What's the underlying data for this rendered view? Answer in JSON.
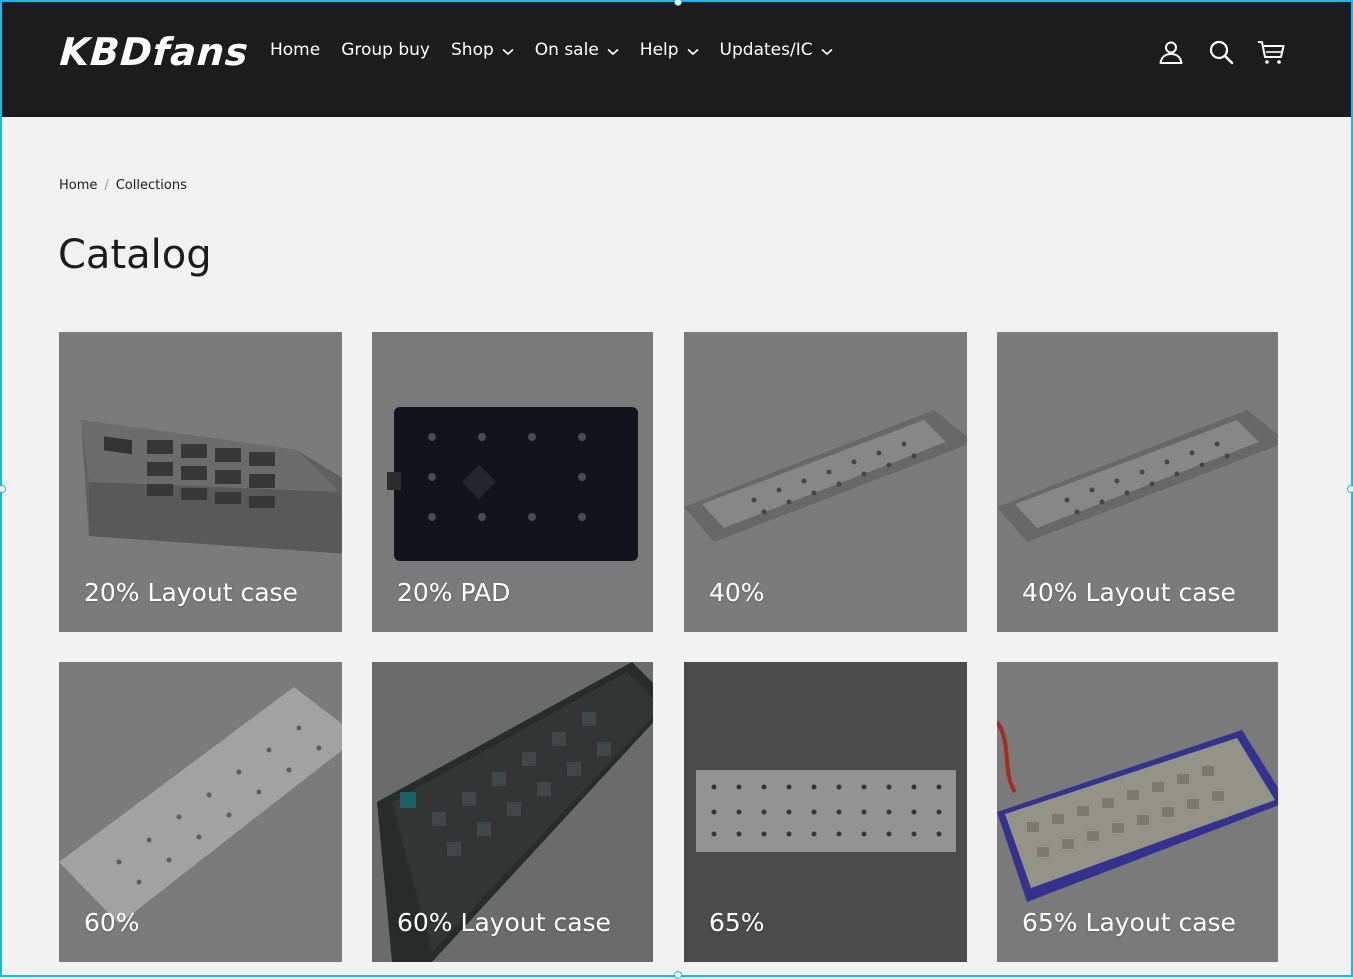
{
  "brand": {
    "logo_text": "KBDfans"
  },
  "nav": {
    "items": [
      {
        "label": "Home",
        "has_dropdown": false
      },
      {
        "label": "Group buy",
        "has_dropdown": false
      },
      {
        "label": "Shop",
        "has_dropdown": true
      },
      {
        "label": "On sale",
        "has_dropdown": true
      },
      {
        "label": "Help",
        "has_dropdown": true
      },
      {
        "label": "Updates/IC",
        "has_dropdown": true
      }
    ]
  },
  "header_icons": [
    "account-icon",
    "search-icon",
    "cart-icon"
  ],
  "breadcrumb": {
    "home": "Home",
    "separator": "/",
    "current": "Collections"
  },
  "page": {
    "title": "Catalog"
  },
  "collections": [
    {
      "label": "20% Layout case"
    },
    {
      "label": "20% PAD"
    },
    {
      "label": "40%"
    },
    {
      "label": "40% Layout case"
    },
    {
      "label": "60%"
    },
    {
      "label": "60% Layout case"
    },
    {
      "label": "65%"
    },
    {
      "label": "65% Layout case"
    }
  ],
  "colors": {
    "header_bg": "#1c1c1c",
    "page_bg": "#f2f2f2",
    "text": "#1c1c1c",
    "selection_border": "#1fb6ee"
  }
}
